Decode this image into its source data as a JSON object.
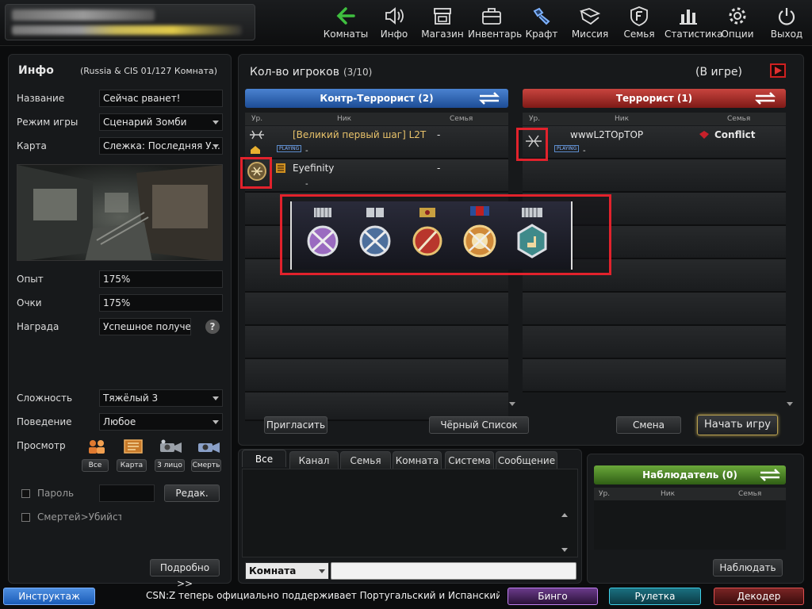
{
  "topnav": [
    {
      "label": "Комнаты",
      "icon": "arrow-left-icon"
    },
    {
      "label": "Инфо",
      "icon": "speaker-icon"
    },
    {
      "label": "Магазин",
      "icon": "shop-icon"
    },
    {
      "label": "Инвентарь",
      "icon": "briefcase-icon"
    },
    {
      "label": "Крафт",
      "icon": "craft-icon"
    },
    {
      "label": "Миссия",
      "icon": "mission-icon"
    },
    {
      "label": "Семья",
      "icon": "family-icon"
    },
    {
      "label": "Статистика",
      "icon": "stats-icon"
    },
    {
      "label": "Опции",
      "icon": "gear-icon"
    },
    {
      "label": "Выход",
      "icon": "power-icon"
    }
  ],
  "info": {
    "title": "Инфо",
    "room": "(Russia & CIS 01/127 Комната)",
    "name_label": "Название",
    "name_value": "Сейчас рванет!",
    "mode_label": "Режим игры",
    "mode_value": "Сценарий Зомби",
    "map_label": "Карта",
    "map_value": "Слежка: Последняя У...",
    "exp_label": "Опыт",
    "exp_value": "175%",
    "points_label": "Очки",
    "points_value": "175%",
    "reward_label": "Награда",
    "reward_value": "Успешное получени",
    "difficulty_label": "Сложность",
    "difficulty_value": "Тяжёлый 3",
    "behavior_label": "Поведение",
    "behavior_value": "Любое",
    "view_label": "Просмотр",
    "view_buttons": [
      "Все",
      "Карта",
      "3 лицо",
      "Смерть"
    ],
    "password_label": "Пароль",
    "edit_button": "Редак.",
    "deaths_label": "Смертей>Убийств",
    "more_button": "Подробно >>"
  },
  "players": {
    "count_label": "Кол-во игроков",
    "count_value": "(3/10)",
    "status": "(В игре)",
    "ct_team": "Контр-Террорист (2)",
    "t_team": "Террорист (1)",
    "col_level": "Ур.",
    "col_nick": "Ник",
    "col_family": "Семья",
    "playing_badge": "PLAYING",
    "ct_players": [
      {
        "nick": "[Великий первый шаг] L2T",
        "family": "-",
        "sub": "-"
      },
      {
        "nick": "Eyefinity",
        "family": "-",
        "sub": "-"
      }
    ],
    "t_players": [
      {
        "nick": "wwwL2TOpTOP",
        "family": "Conflict",
        "sub": "-"
      }
    ],
    "invite_button": "Пригласить",
    "blacklist_button": "Чёрный Список",
    "swap_button": "Смена",
    "start_button": "Начать игру"
  },
  "chat": {
    "tabs": [
      "Все",
      "Канал",
      "Семья",
      "Комната",
      "Система",
      "Сообщение"
    ],
    "channel_select": "Комната",
    "input_value": ""
  },
  "observer": {
    "title": "Наблюдатель (0)",
    "col_level": "Ур.",
    "col_nick": "Ник",
    "col_family": "Семья",
    "watch_button": "Наблюдать"
  },
  "bottom": {
    "tutorial": "Инструктаж",
    "ticker": "CSN:Z теперь официально поддерживает Португальский и Испанский язык",
    "bingo": "Бинго",
    "roulette": "Рулетка",
    "decoder": "Декодер"
  },
  "colors": {
    "ct_header": "#2d67b8",
    "t_header": "#b8302d",
    "observer_header": "#4f8a2a",
    "highlight_box": "#e2222c",
    "gold_text": "#e8c26a"
  }
}
